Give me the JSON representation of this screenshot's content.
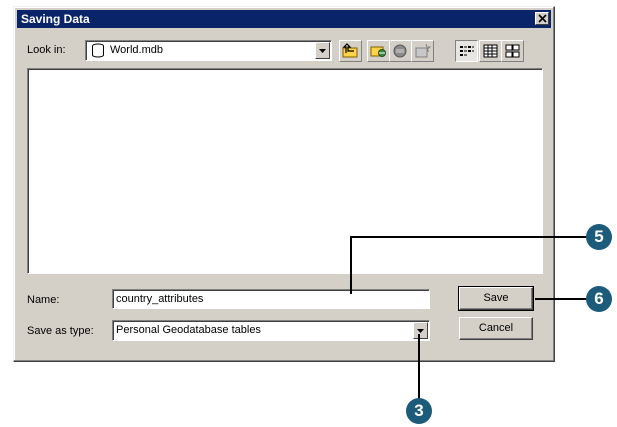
{
  "dialog": {
    "title": "Saving Data",
    "look_in_label": "Look in:",
    "look_in_value": "World.mdb",
    "name_label": "Name:",
    "name_value": "country_attributes",
    "type_label": "Save as type:",
    "type_value": "Personal Geodatabase tables",
    "save_label": "Save",
    "cancel_label": "Cancel"
  },
  "toolbar": {
    "icons": [
      "up-one-level-icon",
      "connect-folder-icon",
      "disconnect-folder-icon",
      "new-item-icon",
      "list-view-icon",
      "details-view-icon",
      "thumbnails-view-icon"
    ],
    "active_view": "list-view-icon"
  },
  "callouts": {
    "name_step": "5",
    "save_step": "6",
    "type_step": "3"
  },
  "colors": {
    "titlebar": "#0a246a",
    "dialog_face": "#d4d0c8",
    "callout": "#1c5c7a"
  }
}
